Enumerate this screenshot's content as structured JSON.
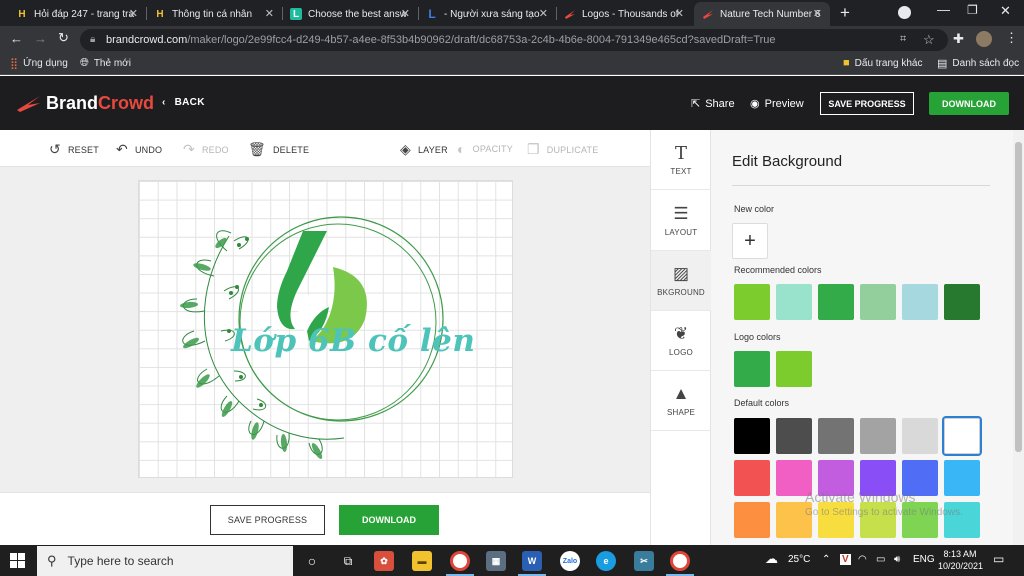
{
  "browser": {
    "tabs": [
      {
        "icon_text": "H",
        "icon_color": "#f2c12e",
        "title": "Hỏi đáp 247 - trang tra"
      },
      {
        "icon_text": "H",
        "icon_color": "#f2c12e",
        "title": "Thông tin cá nhân"
      },
      {
        "icon_text": "L",
        "icon_color": "#1ebc9c",
        "title": "Choose the best answ"
      },
      {
        "icon_text": "L",
        "icon_color": "#3d7ee0",
        "title": "- Người xưa sáng tạo"
      },
      {
        "icon_text": "",
        "icon_color": "#e8493f",
        "title": "Logos - Thousands of"
      },
      {
        "icon_text": "",
        "icon_color": "#e8493f",
        "title": "Nature Tech Number 6"
      }
    ],
    "url_host": "brandcrowd.com",
    "url_path": "/maker/logo/2e99fcc4-d249-4b57-a4ee-8f53b4b90962/draft/dc68753a-2c4b-4b6e-8004-791349e465cd?savedDraft=True",
    "bookmarks": {
      "apps": "Ứng dụng",
      "new": "Thẻ mới",
      "other": "Dấu trang khác",
      "reading_list": "Danh sách đọc"
    }
  },
  "header": {
    "logo_brand": "Brand",
    "logo_crowd": "Crowd",
    "back": "BACK",
    "share": "Share",
    "preview": "Preview",
    "save_progress": "SAVE PROGRESS",
    "download": "DOWNLOAD"
  },
  "editor_toolbar": {
    "reset": "RESET",
    "undo": "UNDO",
    "redo": "REDO",
    "delete": "DELETE",
    "layer": "LAYER",
    "opacity": "OPACITY",
    "duplicate": "DUPLICATE"
  },
  "canvas": {
    "logo_text": "Lớp 6B cố lên",
    "colors": {
      "leaf_dark": "#2ea44f",
      "leaf_light": "#7cc84a",
      "text": "#4ec3ba",
      "wreath": "#3f9b4a"
    }
  },
  "bottom_bar": {
    "save_progress": "SAVE PROGRESS",
    "download": "DOWNLOAD"
  },
  "side_tabs": [
    {
      "label": "TEXT",
      "icon": "text-icon"
    },
    {
      "label": "LAYOUT",
      "icon": "layout-icon"
    },
    {
      "label": "BKGROUND",
      "icon": "background-icon"
    },
    {
      "label": "LOGO",
      "icon": "logo-icon"
    },
    {
      "label": "SHAPE",
      "icon": "shape-icon"
    }
  ],
  "panel": {
    "title": "Edit Background",
    "new_color": "New color",
    "recommended_title": "Recommended colors",
    "recommended": [
      "#7ccc2e",
      "#99e3cc",
      "#33ab48",
      "#92cf9c",
      "#a6d8df",
      "#27792f"
    ],
    "logo_colors_title": "Logo colors",
    "logo_colors": [
      "#33ab48",
      "#7ccc2e"
    ],
    "default_title": "Default colors",
    "default_rows": [
      [
        "#000000",
        "#4d4d4d",
        "#737373",
        "#a3a3a3",
        "#d9d9d9",
        "#ffffff"
      ],
      [
        "#f35252",
        "#f25fc4",
        "#c25de0",
        "#8a4ef7",
        "#4f6ef5",
        "#38b6f5"
      ],
      [
        "#fc9040",
        "#fcc24a",
        "#f7de3e",
        "#c6e04c",
        "#7fd454",
        "#4ad6d8"
      ]
    ],
    "selected_default": "#ffffff"
  },
  "os": {
    "activate_title": "Activate Windows",
    "activate_sub": "Go to Settings to activate Windows.",
    "search_placeholder": "Type here to search",
    "temperature": "25°C",
    "lang": "ENG",
    "time": "8:13 AM",
    "date": "10/20/2021"
  }
}
